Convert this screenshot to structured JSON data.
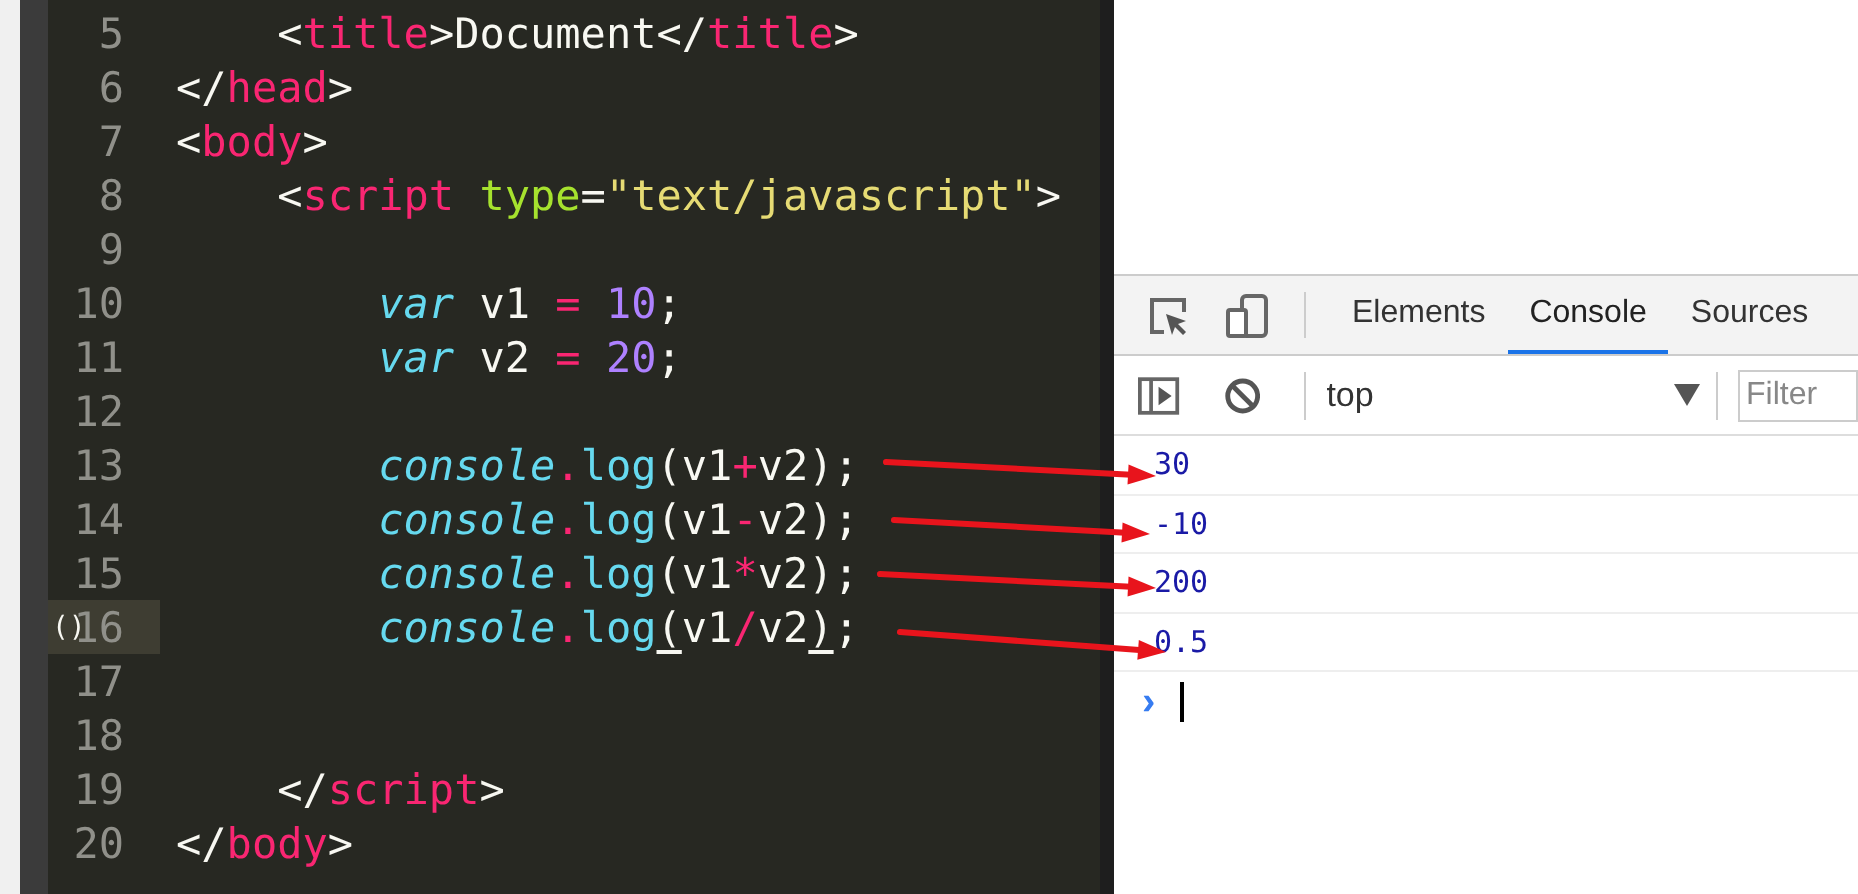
{
  "editor": {
    "lines": [
      {
        "number": "5",
        "current": false,
        "tokens": [
          {
            "kind": "plain",
            "text": "    <"
          },
          {
            "kind": "tag",
            "text": "title"
          },
          {
            "kind": "plain",
            "text": ">Document</"
          },
          {
            "kind": "tag",
            "text": "title"
          },
          {
            "kind": "plain",
            "text": ">"
          }
        ]
      },
      {
        "number": "6",
        "current": false,
        "tokens": [
          {
            "kind": "plain",
            "text": "</"
          },
          {
            "kind": "tag",
            "text": "head"
          },
          {
            "kind": "plain",
            "text": ">"
          }
        ]
      },
      {
        "number": "7",
        "current": false,
        "tokens": [
          {
            "kind": "plain",
            "text": "<"
          },
          {
            "kind": "tag",
            "text": "body"
          },
          {
            "kind": "plain",
            "text": ">"
          }
        ]
      },
      {
        "number": "8",
        "current": false,
        "tokens": [
          {
            "kind": "plain",
            "text": "    <"
          },
          {
            "kind": "tag",
            "text": "script"
          },
          {
            "kind": "attr",
            "text": " type"
          },
          {
            "kind": "plain",
            "text": "="
          },
          {
            "kind": "string",
            "text": "\"text/javascript\""
          },
          {
            "kind": "plain",
            "text": ">"
          }
        ]
      },
      {
        "number": "9",
        "current": false
      },
      {
        "number": "10",
        "current": false,
        "tokens": [
          {
            "kind": "keyword",
            "text": "        var"
          },
          {
            "kind": "plain",
            "text": " v1 "
          },
          {
            "kind": "op",
            "text": "="
          },
          {
            "kind": "number",
            "text": " 10"
          },
          {
            "kind": "plain",
            "text": ";"
          }
        ]
      },
      {
        "number": "11",
        "current": false,
        "tokens": [
          {
            "kind": "keyword",
            "text": "        var"
          },
          {
            "kind": "plain",
            "text": " v2 "
          },
          {
            "kind": "op",
            "text": "="
          },
          {
            "kind": "number",
            "text": " 20"
          },
          {
            "kind": "plain",
            "text": ";"
          }
        ]
      },
      {
        "number": "12",
        "current": false
      },
      {
        "number": "13",
        "current": false,
        "tokens": [
          {
            "kind": "keyword",
            "text": "        console"
          },
          {
            "kind": "op",
            "text": "."
          },
          {
            "kind": "func",
            "text": "log"
          },
          {
            "kind": "plain",
            "text": "(v1"
          },
          {
            "kind": "op",
            "text": "+"
          },
          {
            "kind": "plain",
            "text": "v2);"
          }
        ]
      },
      {
        "number": "14",
        "current": false,
        "tokens": [
          {
            "kind": "keyword",
            "text": "        console"
          },
          {
            "kind": "op",
            "text": "."
          },
          {
            "kind": "func",
            "text": "log"
          },
          {
            "kind": "plain",
            "text": "(v1"
          },
          {
            "kind": "op",
            "text": "-"
          },
          {
            "kind": "plain",
            "text": "v2);"
          }
        ]
      },
      {
        "number": "15",
        "current": false,
        "tokens": [
          {
            "kind": "keyword",
            "text": "        console"
          },
          {
            "kind": "op",
            "text": "."
          },
          {
            "kind": "func",
            "text": "log"
          },
          {
            "kind": "plain",
            "text": "(v1"
          },
          {
            "kind": "op",
            "text": "*"
          },
          {
            "kind": "plain",
            "text": "v2);"
          }
        ]
      },
      {
        "number": "16",
        "current": true,
        "marker": "()",
        "tokens": [
          {
            "kind": "keyword",
            "text": "        console"
          },
          {
            "kind": "op",
            "text": "."
          },
          {
            "kind": "func",
            "text": "log"
          },
          {
            "kind": "match",
            "text": "("
          },
          {
            "kind": "plain",
            "text": "v1"
          },
          {
            "kind": "op",
            "text": "/"
          },
          {
            "kind": "plain",
            "text": "v2"
          },
          {
            "kind": "match",
            "text": ")"
          },
          {
            "kind": "plain",
            "text": ";"
          }
        ]
      },
      {
        "number": "17",
        "current": false
      },
      {
        "number": "18",
        "current": false
      },
      {
        "number": "19",
        "current": false,
        "tokens": [
          {
            "kind": "plain",
            "text": "    </"
          },
          {
            "kind": "tag",
            "text": "script"
          },
          {
            "kind": "plain",
            "text": ">"
          }
        ]
      },
      {
        "number": "20",
        "current": false,
        "tokens": [
          {
            "kind": "plain",
            "text": "</"
          },
          {
            "kind": "tag",
            "text": "body"
          },
          {
            "kind": "plain",
            "text": ">"
          }
        ]
      }
    ]
  },
  "devtools": {
    "tabs": [
      {
        "label": "Elements",
        "selected": false
      },
      {
        "label": "Console",
        "selected": true
      },
      {
        "label": "Sources",
        "selected": false
      }
    ],
    "context": "top",
    "filter": {
      "placeholder": "Filter"
    },
    "messages": [
      {
        "text": "30",
        "annotated": true
      },
      {
        "text": "-10",
        "annotated": true
      },
      {
        "text": "200",
        "annotated": true
      },
      {
        "text": "0.5",
        "annotated": true
      }
    ],
    "prompt": "›"
  }
}
